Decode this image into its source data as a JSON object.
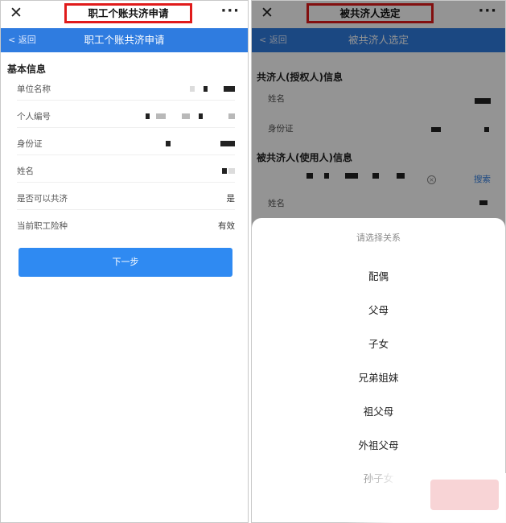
{
  "left": {
    "wechat_title": "职工个账共济申请",
    "more": "···",
    "close": "✕",
    "nav": {
      "back": "< 返回",
      "title": "职工个账共济申请"
    },
    "section_title": "基本信息",
    "rows": [
      {
        "label": "单位名称",
        "value": ""
      },
      {
        "label": "个人编号",
        "value": ""
      },
      {
        "label": "身份证",
        "value": ""
      },
      {
        "label": "姓名",
        "value": ""
      },
      {
        "label": "是否可以共济",
        "value": "是"
      },
      {
        "label": "当前职工险种",
        "value": "有效"
      }
    ],
    "next_button": "下一步"
  },
  "right": {
    "wechat_title": "被共济人选定",
    "more": "···",
    "close": "✕",
    "nav": {
      "back": "< 返回",
      "title": "被共济人选定"
    },
    "section1": "共济人(授权人)信息",
    "section1_fields": [
      "姓名",
      "身份证"
    ],
    "section2": "被共济人(使用人)信息",
    "search": "搜索",
    "section2_fields": [
      "姓名"
    ],
    "sheet": {
      "title": "请选择关系",
      "options": [
        "配偶",
        "父母",
        "子女",
        "兄弟姐妹",
        "祖父母",
        "外祖父母",
        "孙子女"
      ]
    }
  }
}
